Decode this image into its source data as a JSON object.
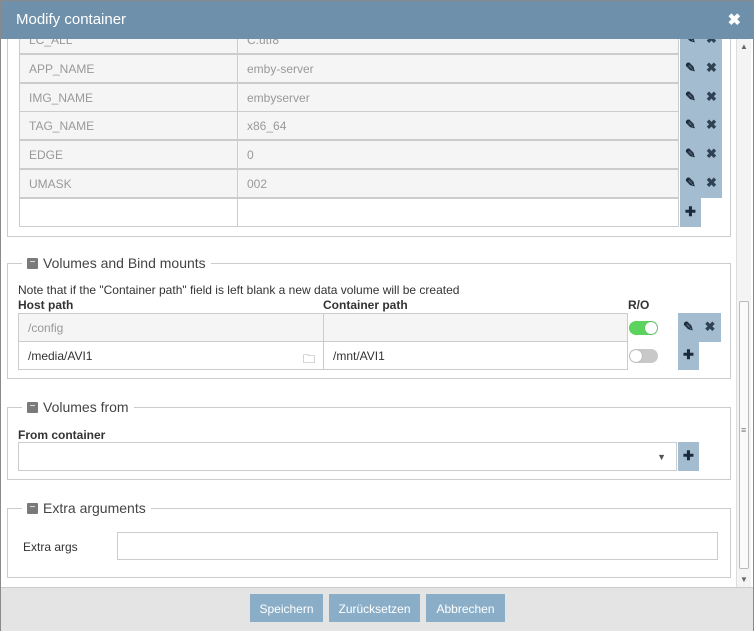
{
  "dialog": {
    "title": "Modify container",
    "close_glyph": "✖"
  },
  "env": {
    "rows": [
      {
        "key": "LC_ALL",
        "value": "C.utf8"
      },
      {
        "key": "APP_NAME",
        "value": "emby-server"
      },
      {
        "key": "IMG_NAME",
        "value": "embyserver"
      },
      {
        "key": "TAG_NAME",
        "value": "x86_64"
      },
      {
        "key": "EDGE",
        "value": "0"
      },
      {
        "key": "UMASK",
        "value": "002"
      }
    ],
    "edit_glyph": "✎",
    "remove_glyph": "✖",
    "add_glyph": "✚"
  },
  "volumes": {
    "legend": "Volumes and Bind mounts",
    "note": "Note that if the \"Container path\" field is left blank a new data volume will be created",
    "host_header": "Host path",
    "container_header": "Container path",
    "ro_header": "R/O",
    "rows": [
      {
        "host": "/config",
        "container": "",
        "readonly": true
      },
      {
        "host": "/media/AVI1",
        "container": "/mnt/AVI1",
        "readonly": false
      }
    ]
  },
  "volumes_from": {
    "legend": "Volumes from",
    "label": "From container",
    "selected": ""
  },
  "extra": {
    "legend": "Extra arguments",
    "label": "Extra args",
    "value": ""
  },
  "buttons": {
    "save": "Speichern",
    "reset": "Zurücksetzen",
    "cancel": "Abbrechen"
  },
  "colors": {
    "titlebar": "#6e90ab",
    "action_button": "#a3bccf",
    "footer_button": "#8aaec8",
    "toggle_on": "#5cd35c"
  }
}
